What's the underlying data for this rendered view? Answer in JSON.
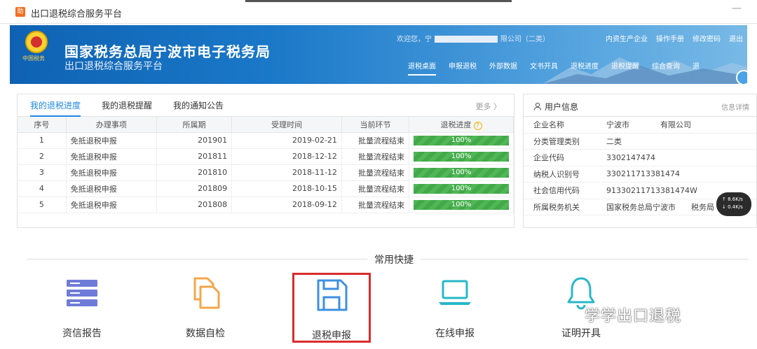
{
  "window": {
    "title": "出口退税综合服务平台",
    "app_icon": "助"
  },
  "banner": {
    "emblem_label": "中国税务",
    "title": "国家税务总局宁波市电子税务局",
    "subtitle": "出口退税综合服务平台",
    "welcome_prefix": "欢迎您，宁",
    "welcome_suffix": "限公司（二类）",
    "links": [
      "内资生产企业",
      "操作手册",
      "修改密码",
      "退出"
    ],
    "nav": [
      "退税桌面",
      "申报退税",
      "外部数据",
      "文书开具",
      "退税进度",
      "退税提醒",
      "综合查询",
      "退"
    ]
  },
  "progress": {
    "tabs": [
      "我的退税进度",
      "我的退税提醒",
      "我的通知公告"
    ],
    "more": "更多 〉",
    "headers": [
      "序号",
      "办理事项",
      "所属期",
      "受理时间",
      "当前环节",
      "退税进度"
    ],
    "rows": [
      [
        "1",
        "免抵退税申报",
        "201901",
        "2019-02-21",
        "批量流程结束",
        "100%"
      ],
      [
        "2",
        "免抵退税申报",
        "201811",
        "2018-12-12",
        "批量流程结束",
        "100%"
      ],
      [
        "3",
        "免抵退税申报",
        "201810",
        "2018-11-12",
        "批量流程结束",
        "100%"
      ],
      [
        "4",
        "免抵退税申报",
        "201809",
        "2018-10-15",
        "批量流程结束",
        "100%"
      ],
      [
        "5",
        "免抵退税申报",
        "201808",
        "2018-09-12",
        "批量流程结束",
        "100%"
      ]
    ],
    "help_icon": "?"
  },
  "user": {
    "title": "用户信息",
    "detail": "信息详情",
    "rows": [
      {
        "k": "企业名称",
        "v": "宁波市　　　　有限公司"
      },
      {
        "k": "分类管理类别",
        "v": "二类"
      },
      {
        "k": "企业代码",
        "v": "3302147474"
      },
      {
        "k": "纳税人识别号",
        "v": "330211713381474"
      },
      {
        "k": "社会信用代码",
        "v": "91330211713381474W"
      },
      {
        "k": "所属税务机关",
        "v": "国家税务总局宁波市　　税务局"
      }
    ]
  },
  "speed": {
    "up": "↑ 8.6K/s",
    "down": "↓ 0.4K/s"
  },
  "quick": {
    "title": "常用快捷",
    "items": [
      "资信报告",
      "数据自检",
      "退税申报",
      "在线申报",
      "证明开具"
    ]
  },
  "watermark": "学学出口退税",
  "colors": {
    "accent": "#1e88e5",
    "progress": "#4fb855",
    "highlight": "#d92c2c",
    "icon": "#6f7bd8",
    "icon2": "#f5a64a",
    "icon3": "#3f8fe0",
    "icon4": "#27b7c8"
  }
}
